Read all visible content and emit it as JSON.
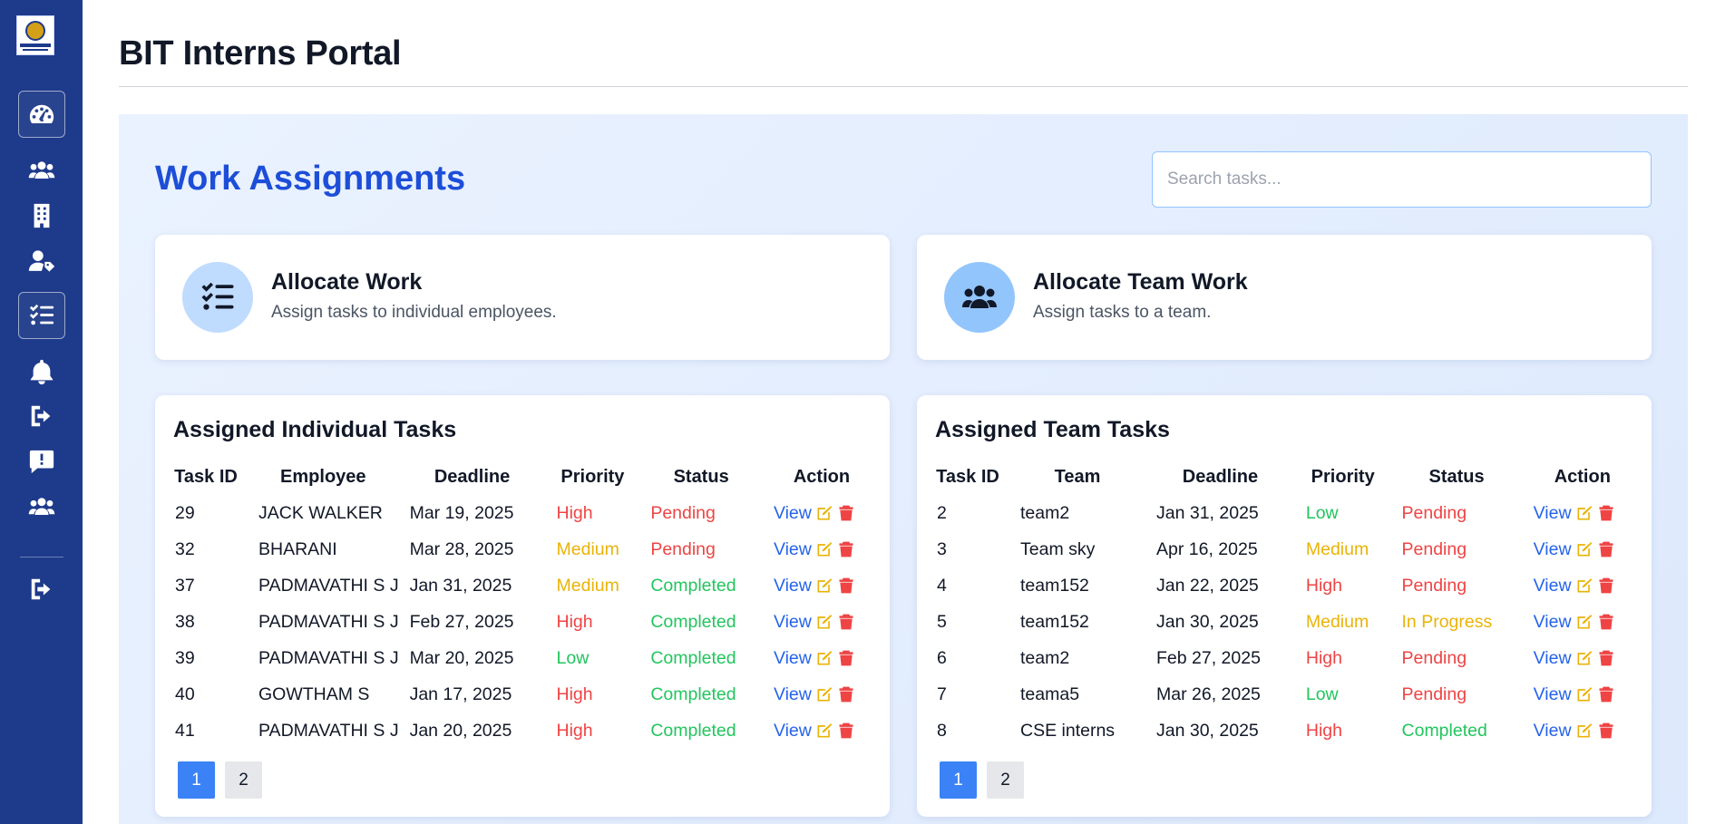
{
  "app": {
    "title": "BIT Interns Portal"
  },
  "colors": {
    "sidebar": "#1e3a8a",
    "accent": "#1d4ed8",
    "danger": "#ef4444",
    "warning": "#eab308",
    "success": "#22c55e",
    "pager_active": "#3b82f6"
  },
  "sidebar": {
    "items": [
      {
        "icon": "dashboard-gauge-icon",
        "active": true
      },
      {
        "icon": "users-icon"
      },
      {
        "icon": "building-icon"
      },
      {
        "icon": "user-tag-icon"
      },
      {
        "icon": "task-list-icon",
        "active": true
      },
      {
        "icon": "bell-icon"
      },
      {
        "icon": "sign-out-icon"
      },
      {
        "icon": "feedback-alert-icon"
      },
      {
        "icon": "team-users-icon"
      },
      {
        "icon": "logout-icon"
      }
    ]
  },
  "main": {
    "section_title": "Work Assignments",
    "search": {
      "placeholder": "Search tasks...",
      "value": ""
    },
    "allocate_individual": {
      "title": "Allocate Work",
      "description": "Assign tasks to individual employees.",
      "icon": "task-checklist-icon"
    },
    "allocate_team": {
      "title": "Allocate Team Work",
      "description": "Assign tasks to a team.",
      "icon": "team-users-icon"
    }
  },
  "individual_tasks": {
    "title": "Assigned Individual Tasks",
    "columns": [
      "Task ID",
      "Employee",
      "Deadline",
      "Priority",
      "Status",
      "Action"
    ],
    "rows": [
      {
        "id": "29",
        "name": "JACK WALKER",
        "deadline": "Mar 19, 2025",
        "priority": "High",
        "status": "Pending",
        "action": "View"
      },
      {
        "id": "32",
        "name": "BHARANI",
        "deadline": "Mar 28, 2025",
        "priority": "Medium",
        "status": "Pending",
        "action": "View"
      },
      {
        "id": "37",
        "name": "PADMAVATHI S J",
        "deadline": "Jan 31, 2025",
        "priority": "Medium",
        "status": "Completed",
        "action": "View"
      },
      {
        "id": "38",
        "name": "PADMAVATHI S J",
        "deadline": "Feb 27, 2025",
        "priority": "High",
        "status": "Completed",
        "action": "View"
      },
      {
        "id": "39",
        "name": "PADMAVATHI S J",
        "deadline": "Mar 20, 2025",
        "priority": "Low",
        "status": "Completed",
        "action": "View"
      },
      {
        "id": "40",
        "name": "GOWTHAM S",
        "deadline": "Jan 17, 2025",
        "priority": "High",
        "status": "Completed",
        "action": "View"
      },
      {
        "id": "41",
        "name": "PADMAVATHI S J",
        "deadline": "Jan 20, 2025",
        "priority": "High",
        "status": "Completed",
        "action": "View"
      }
    ],
    "pages": [
      "1",
      "2"
    ],
    "current_page": "1"
  },
  "team_tasks": {
    "title": "Assigned Team Tasks",
    "columns": [
      "Task ID",
      "Team",
      "Deadline",
      "Priority",
      "Status",
      "Action"
    ],
    "rows": [
      {
        "id": "2",
        "name": "team2",
        "deadline": "Jan 31, 2025",
        "priority": "Low",
        "status": "Pending",
        "action": "View"
      },
      {
        "id": "3",
        "name": "Team sky",
        "deadline": "Apr 16, 2025",
        "priority": "Medium",
        "status": "Pending",
        "action": "View"
      },
      {
        "id": "4",
        "name": "team152",
        "deadline": "Jan 22, 2025",
        "priority": "High",
        "status": "Pending",
        "action": "View"
      },
      {
        "id": "5",
        "name": "team152",
        "deadline": "Jan 30, 2025",
        "priority": "Medium",
        "status": "In Progress",
        "action": "View"
      },
      {
        "id": "6",
        "name": "team2",
        "deadline": "Feb 27, 2025",
        "priority": "High",
        "status": "Pending",
        "action": "View"
      },
      {
        "id": "7",
        "name": "teama5",
        "deadline": "Mar 26, 2025",
        "priority": "Low",
        "status": "Pending",
        "action": "View"
      },
      {
        "id": "8",
        "name": "CSE interns",
        "deadline": "Jan 30, 2025",
        "priority": "High",
        "status": "Completed",
        "action": "View"
      }
    ],
    "pages": [
      "1",
      "2"
    ],
    "current_page": "1"
  }
}
